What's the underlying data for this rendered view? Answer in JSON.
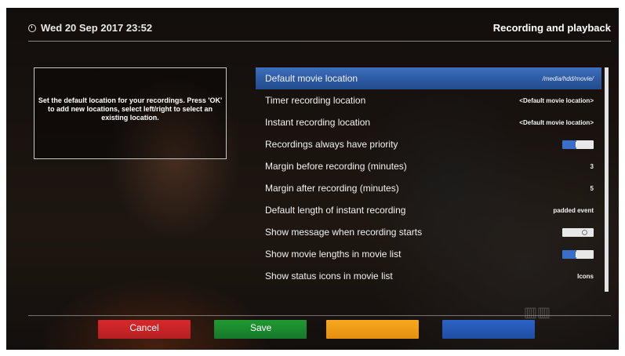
{
  "header": {
    "datetime": "Wed 20 Sep 2017  23:52",
    "title": "Recording and playback"
  },
  "help": {
    "text": "Set the default location for your recordings. Press 'OK' to add new locations, select left/right to select an existing location."
  },
  "menu": {
    "items": [
      {
        "label": "Default movie location",
        "value": "/media/hdd/movie/",
        "selected": true
      },
      {
        "label": "Timer recording location",
        "value": "<Default movie location>"
      },
      {
        "label": "Instant recording location",
        "value": "<Default movie location>"
      },
      {
        "label": "Recordings always have priority",
        "toggle": "on"
      },
      {
        "label": "Margin before recording (minutes)",
        "value": "3"
      },
      {
        "label": "Margin after recording (minutes)",
        "value": "5"
      },
      {
        "label": "Default length of instant recording",
        "value": "padded event"
      },
      {
        "label": "Show message when recording starts",
        "toggle": "off"
      },
      {
        "label": "Show movie lengths in movie list",
        "toggle": "on"
      },
      {
        "label": "Show status icons in movie list",
        "value": "Icons"
      }
    ]
  },
  "buttons": {
    "red": "Cancel",
    "green": "Save",
    "yellow": "",
    "blue": ""
  },
  "colors": {
    "selected_row": "#2a579f",
    "red": "#c62427",
    "green": "#1a8a2f",
    "yellow": "#f0a01a",
    "blue": "#275ab8",
    "toggle_on": "#3b6ec9"
  }
}
